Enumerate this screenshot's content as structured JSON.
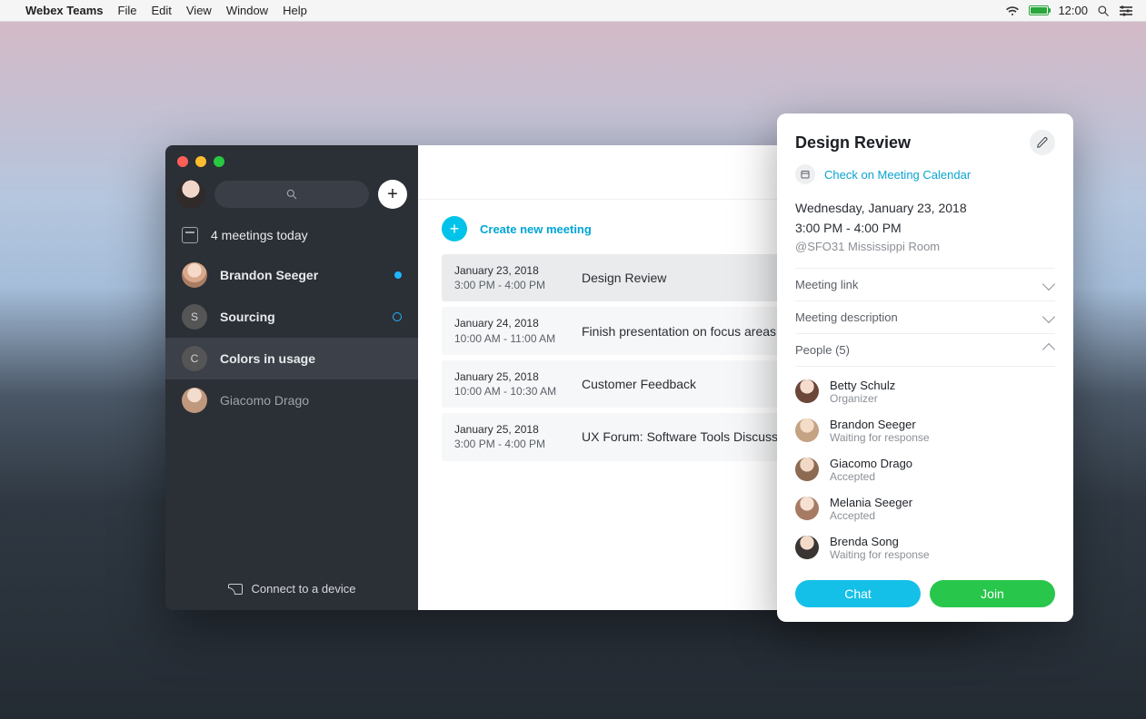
{
  "menubar": {
    "app_name": "Webex Teams",
    "items": [
      "File",
      "Edit",
      "View",
      "Window",
      "Help"
    ],
    "clock": "12:00"
  },
  "sidebar": {
    "meetings_today": "4 meetings today",
    "spaces": [
      {
        "name": "Brandon Seeger",
        "indicator": "blue",
        "avatar": "photo1"
      },
      {
        "name": "Sourcing",
        "indicator": "ring",
        "initial": "S"
      },
      {
        "name": "Colors in usage",
        "selected": true,
        "initial": "C"
      },
      {
        "name": "Giacomo Drago",
        "dim": true,
        "avatar": "photo2"
      }
    ],
    "footer": "Connect to a device"
  },
  "main": {
    "space_selector_label": "Colors in usage",
    "create_meeting_label": "Create new meeting",
    "meetings": [
      {
        "date": "January 23, 2018",
        "time": "3:00 PM - 4:00 PM",
        "title": "Design Review",
        "selected": true
      },
      {
        "date": "January 24, 2018",
        "time": "10:00 AM - 11:00 AM",
        "title": "Finish presentation on focus areas"
      },
      {
        "date": "January 25, 2018",
        "time": "10:00 AM - 10:30 AM",
        "title": "Customer Feedback"
      },
      {
        "date": "January 25, 2018",
        "time": "3:00 PM - 4:00 PM",
        "title": "UX Forum: Software Tools Discussion"
      }
    ]
  },
  "detail": {
    "title": "Design Review",
    "calendar_link": "Check on Meeting Calendar",
    "date": "Wednesday, January 23, 2018",
    "time": "3:00 PM - 4:00 PM",
    "location": "@SFO31 Mississippi Room",
    "sections": {
      "link_label": "Meeting link",
      "description_label": "Meeting description",
      "people_label": "People (5)"
    },
    "people": [
      {
        "name": "Betty Schulz",
        "status": "Organizer",
        "avatar": "f1"
      },
      {
        "name": "Brandon Seeger",
        "status": "Waiting for response",
        "avatar": "m1"
      },
      {
        "name": "Giacomo Drago",
        "status": "Accepted",
        "avatar": "m2"
      },
      {
        "name": "Melania Seeger",
        "status": "Accepted",
        "avatar": "f2"
      },
      {
        "name": "Brenda Song",
        "status": "Waiting for response",
        "avatar": "f3"
      }
    ],
    "chat_label": "Chat",
    "join_label": "Join"
  }
}
